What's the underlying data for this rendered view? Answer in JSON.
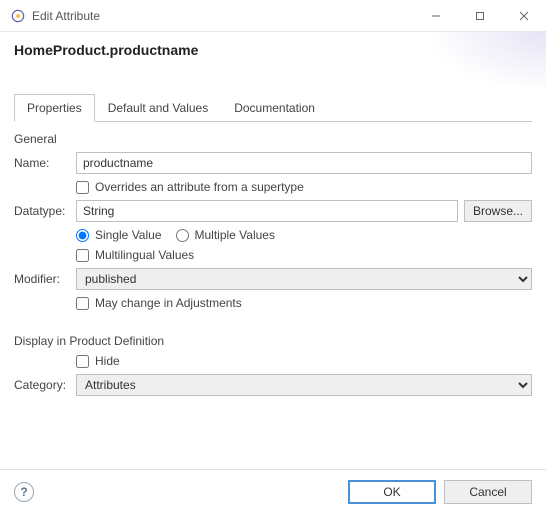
{
  "window": {
    "title": "Edit Attribute"
  },
  "header": {
    "heading": "HomeProduct.productname"
  },
  "tabs": {
    "properties": "Properties",
    "defaultValues": "Default and Values",
    "documentation": "Documentation",
    "active": "properties"
  },
  "form": {
    "generalLabel": "General",
    "nameLabel": "Name:",
    "nameValue": "productname",
    "overridesLabel": "Overrides an attribute from a supertype",
    "overridesChecked": false,
    "datatypeLabel": "Datatype:",
    "datatypeValue": "String",
    "browseLabel": "Browse...",
    "singleValueLabel": "Single Value",
    "multipleValuesLabel": "Multiple Values",
    "valueMode": "single",
    "multilingualLabel": "Multilingual Values",
    "multilingualChecked": false,
    "modifierLabel": "Modifier:",
    "modifierValue": "published",
    "mayChangeLabel": "May change in Adjustments",
    "mayChangeChecked": false,
    "displaySectionLabel": "Display in Product Definition",
    "hideLabel": "Hide",
    "hideChecked": false,
    "categoryLabel": "Category:",
    "categoryValue": "Attributes"
  },
  "footer": {
    "ok": "OK",
    "cancel": "Cancel"
  }
}
